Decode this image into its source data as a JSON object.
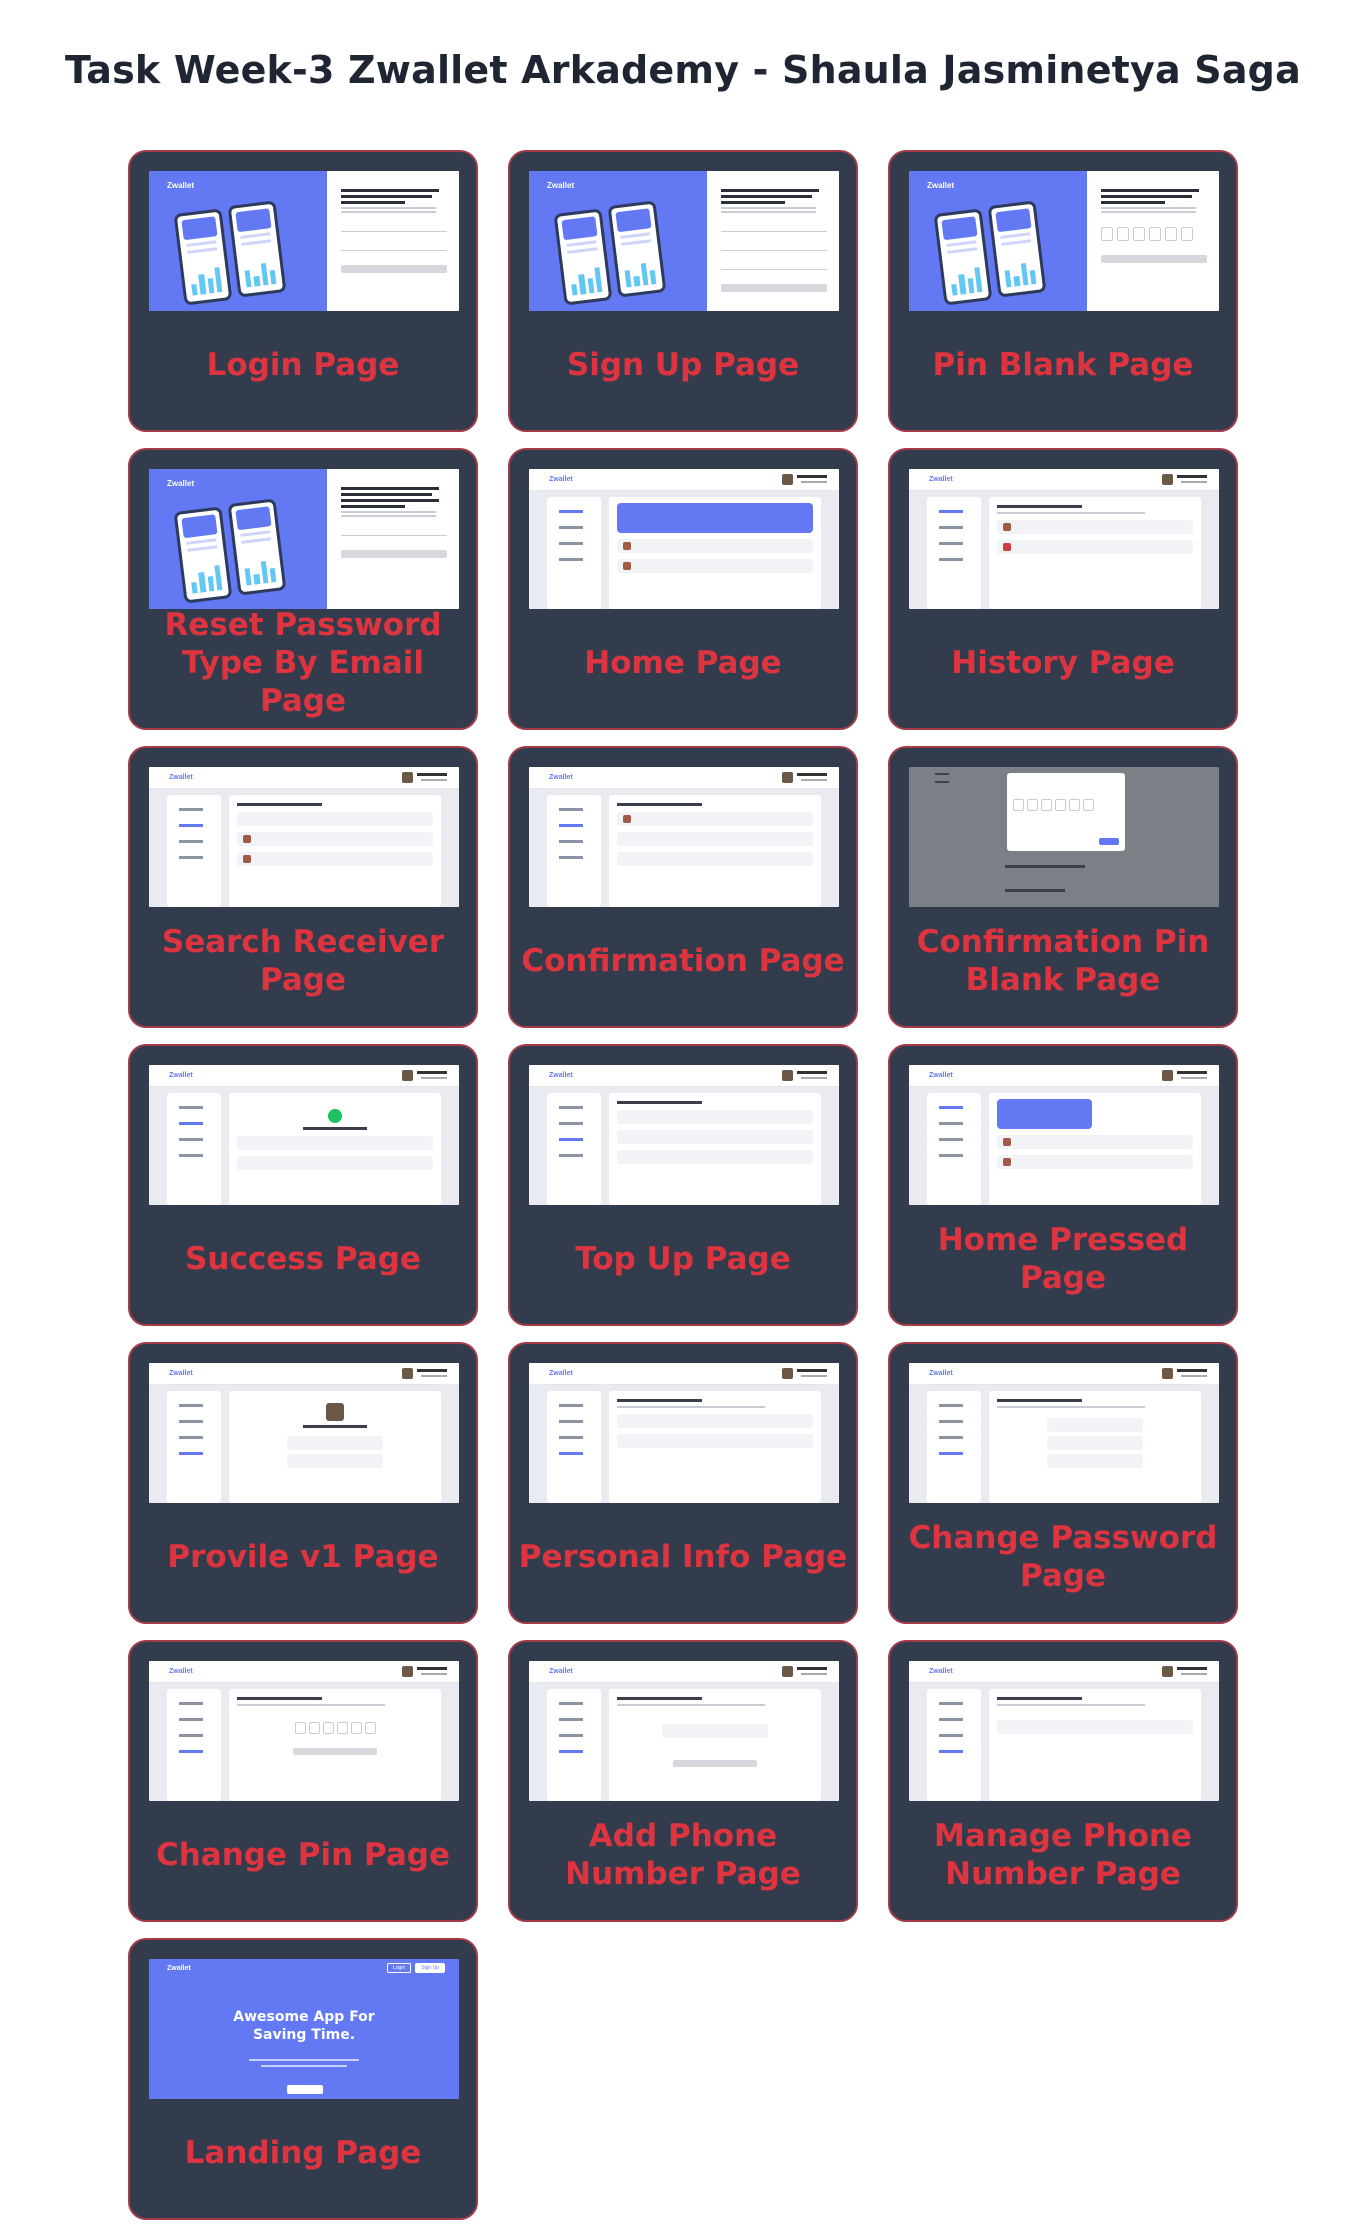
{
  "page": {
    "title": "Task Week-3 Zwallet Arkademy - Shaula Jasminetya Saga"
  },
  "colors": {
    "card_bg": "#323c4d",
    "card_border": "#a33a48",
    "label_color": "#de3440",
    "accent": "#6379f4"
  },
  "thumb_text": {
    "brand": "Zwallet",
    "landing_hero_line1": "Awesome App For",
    "landing_hero_line2": "Saving Time.",
    "landing_login": "Login",
    "landing_signup": "Sign Up"
  },
  "cards": [
    {
      "label": "Login Page",
      "thumb": "auth-login"
    },
    {
      "label": "Sign Up Page",
      "thumb": "auth-signup"
    },
    {
      "label": "Pin Blank Page",
      "thumb": "auth-pin"
    },
    {
      "label": "Reset Password Type By Email Page",
      "thumb": "auth-reset"
    },
    {
      "label": "Home Page",
      "thumb": "dash-home"
    },
    {
      "label": "History Page",
      "thumb": "dash-history"
    },
    {
      "label": "Search Receiver Page",
      "thumb": "dash-search"
    },
    {
      "label": "Confirmation Page",
      "thumb": "dash-confirm"
    },
    {
      "label": "Confirmation Pin Blank Page",
      "thumb": "modal-pin"
    },
    {
      "label": "Success Page",
      "thumb": "dash-success"
    },
    {
      "label": "Top Up Page",
      "thumb": "dash-topup"
    },
    {
      "label": "Home Pressed Page",
      "thumb": "dash-home-pressed"
    },
    {
      "label": "Provile v1 Page",
      "thumb": "dash-profile"
    },
    {
      "label": "Personal Info Page",
      "thumb": "dash-personal"
    },
    {
      "label": "Change Password Page",
      "thumb": "dash-change-pass"
    },
    {
      "label": "Change Pin Page",
      "thumb": "dash-change-pin"
    },
    {
      "label": "Add Phone Number Page",
      "thumb": "dash-add-phone"
    },
    {
      "label": "Manage Phone Number Page",
      "thumb": "dash-manage-phone"
    },
    {
      "label": "Landing Page",
      "thumb": "landing"
    }
  ]
}
